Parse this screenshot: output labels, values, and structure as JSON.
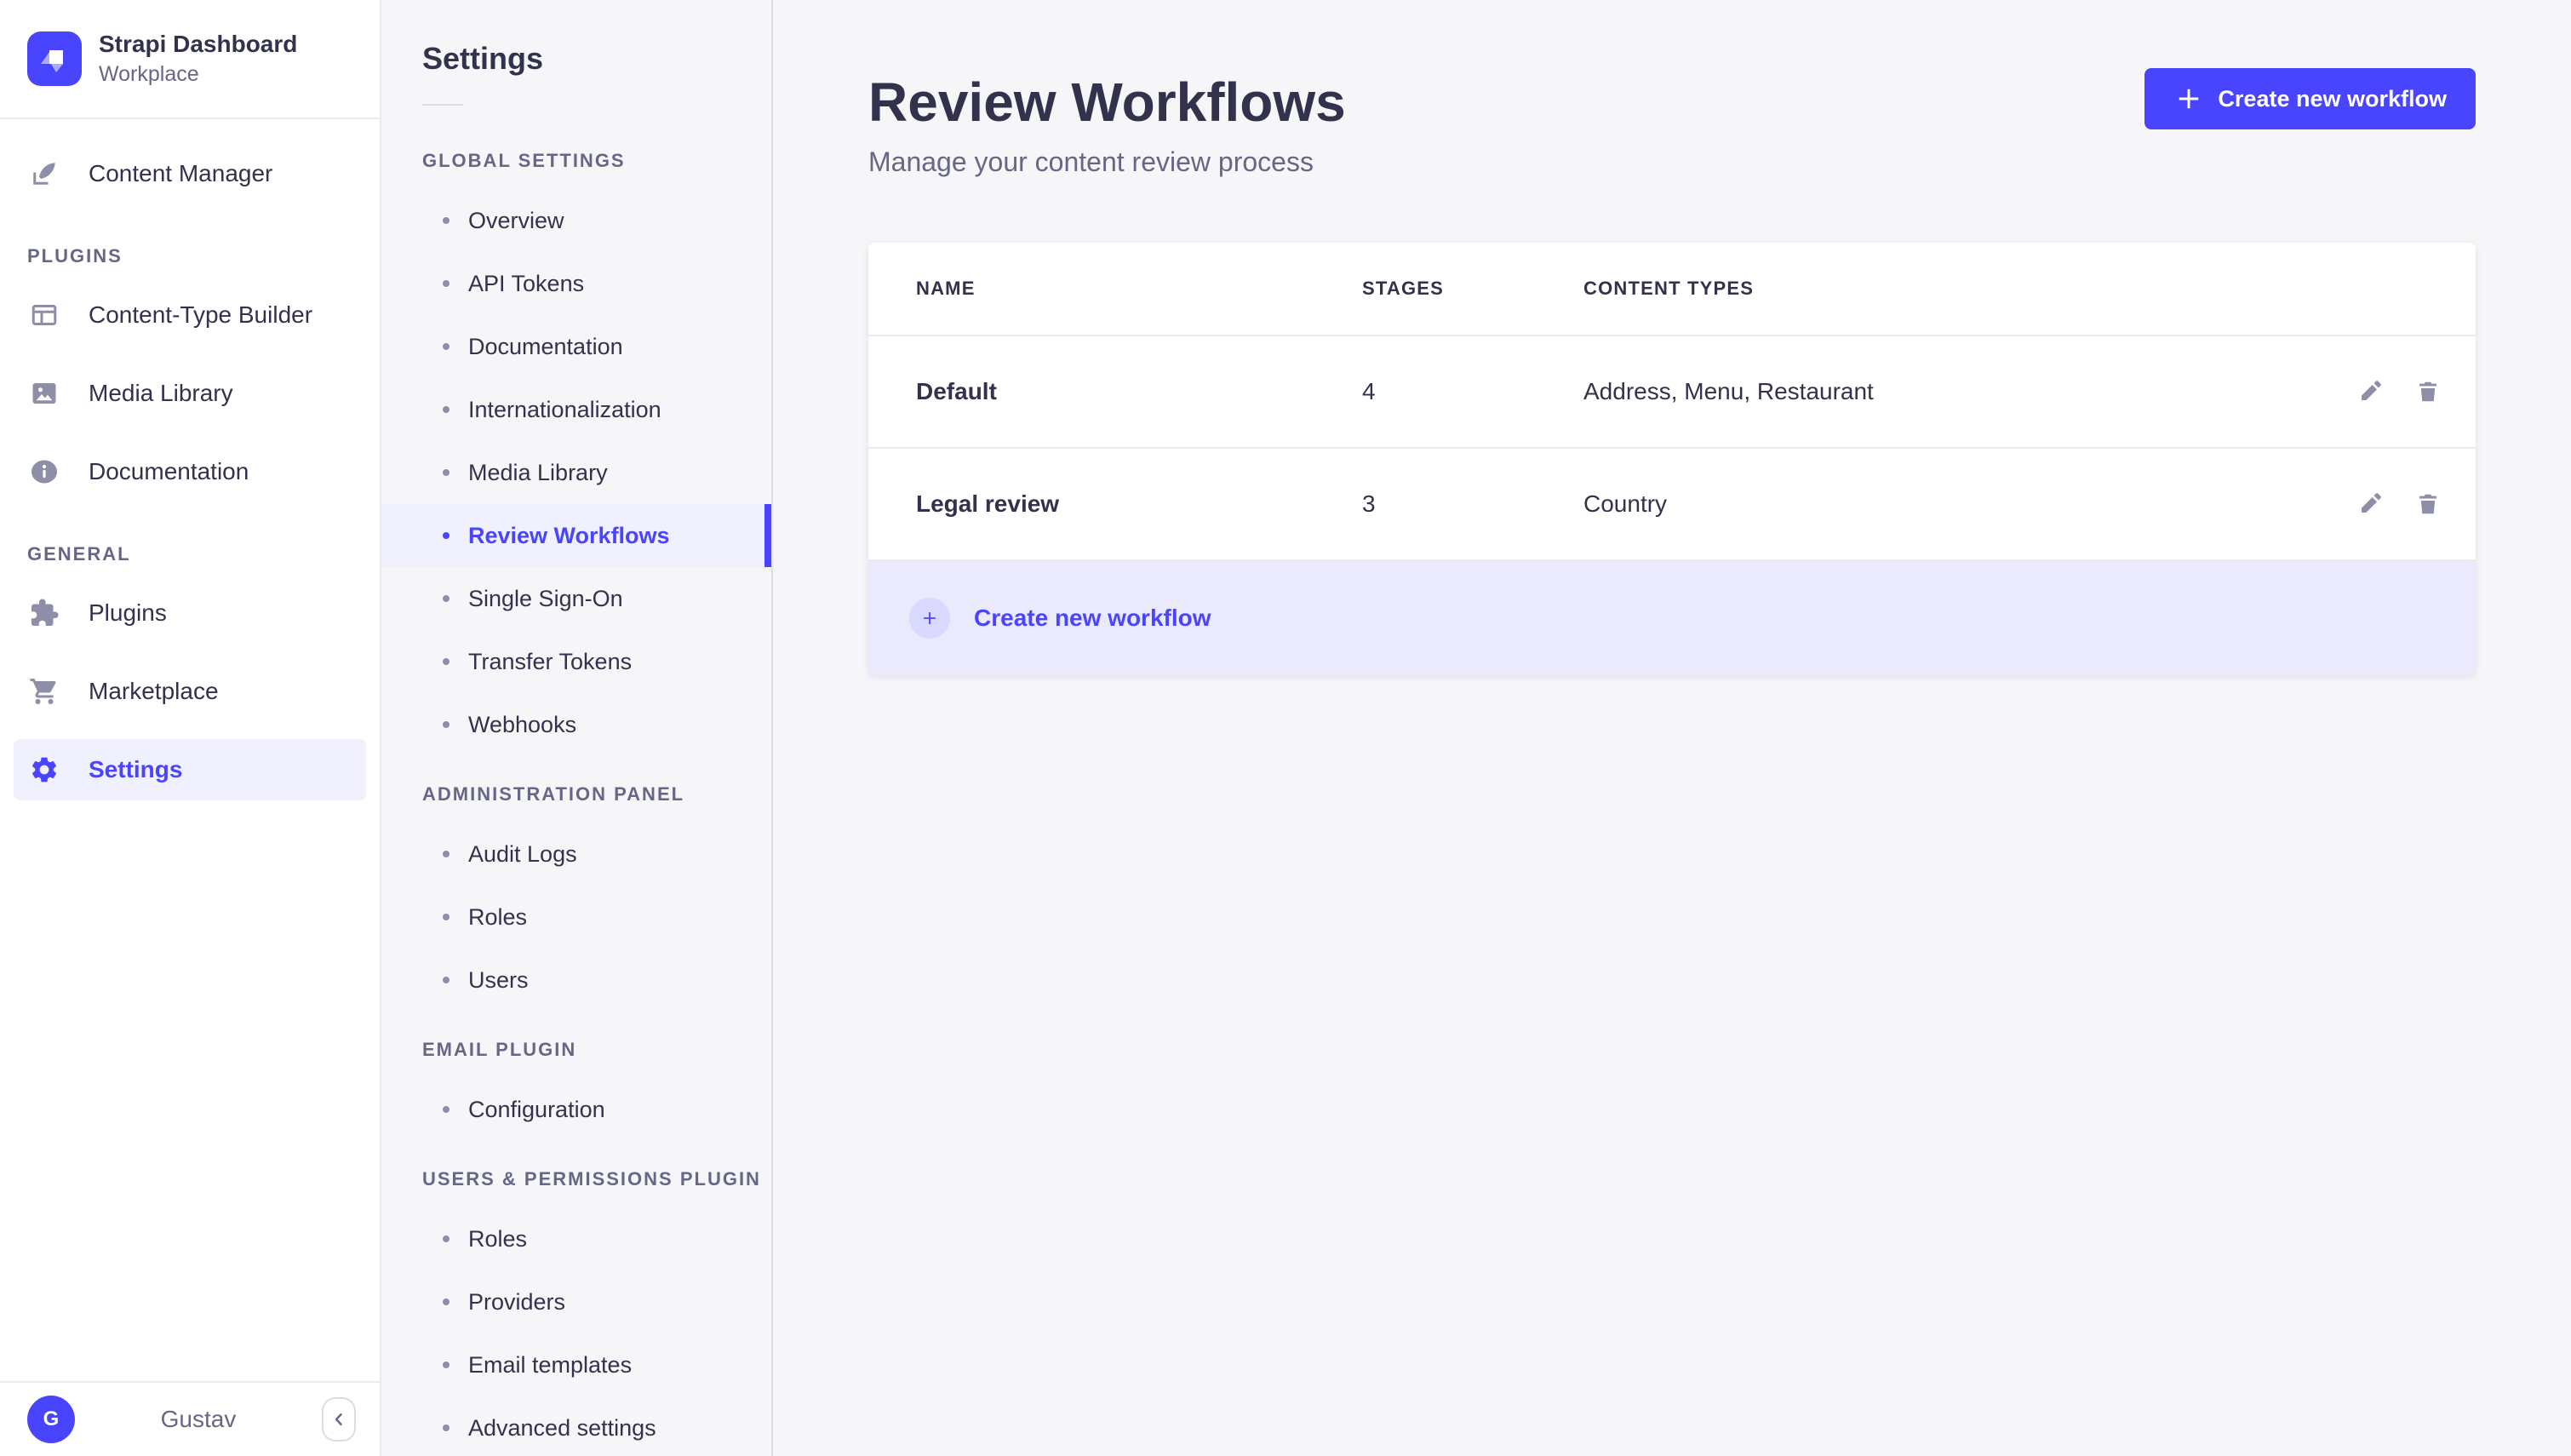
{
  "brand": {
    "name": "Strapi Dashboard",
    "workspace": "Workplace"
  },
  "main_nav": {
    "top_items": [
      {
        "label": "Content Manager",
        "icon": "content-manager-icon"
      }
    ],
    "sections": [
      {
        "label": "PLUGINS",
        "items": [
          {
            "label": "Content-Type Builder",
            "icon": "content-type-builder-icon"
          },
          {
            "label": "Media Library",
            "icon": "media-library-icon"
          },
          {
            "label": "Documentation",
            "icon": "documentation-icon"
          }
        ]
      },
      {
        "label": "GENERAL",
        "items": [
          {
            "label": "Plugins",
            "icon": "plugins-icon"
          },
          {
            "label": "Marketplace",
            "icon": "marketplace-icon"
          },
          {
            "label": "Settings",
            "icon": "settings-icon",
            "active": true
          }
        ]
      }
    ],
    "user": {
      "initial": "G",
      "name": "Gustav"
    }
  },
  "subnav": {
    "title": "Settings",
    "sections": [
      {
        "label": "GLOBAL SETTINGS",
        "items": [
          "Overview",
          "API Tokens",
          "Documentation",
          "Internationalization",
          "Media Library",
          "Review Workflows",
          "Single Sign-On",
          "Transfer Tokens",
          "Webhooks"
        ],
        "active_item": "Review Workflows"
      },
      {
        "label": "ADMINISTRATION PANEL",
        "items": [
          "Audit Logs",
          "Roles",
          "Users"
        ]
      },
      {
        "label": "EMAIL PLUGIN",
        "items": [
          "Configuration"
        ]
      },
      {
        "label": "USERS & PERMISSIONS PLUGIN",
        "items": [
          "Roles",
          "Providers",
          "Email templates",
          "Advanced settings"
        ]
      }
    ]
  },
  "page": {
    "title": "Review Workflows",
    "subtitle": "Manage your content review process",
    "create_button_label": "Create new workflow",
    "table": {
      "headers": [
        "NAME",
        "STAGES",
        "CONTENT TYPES"
      ],
      "rows": [
        {
          "name": "Default",
          "stages": "4",
          "content_types": "Address, Menu, Restaurant"
        },
        {
          "name": "Legal review",
          "stages": "3",
          "content_types": "Country"
        }
      ],
      "footer_action_label": "Create new workflow",
      "row_actions": [
        "edit-icon",
        "delete-icon"
      ]
    }
  },
  "colors": {
    "primary": "#4945ff",
    "primary_light_bg": "#f0f0ff",
    "footer_row_bg": "#eaeafc",
    "text_primary": "#32324d",
    "text_secondary": "#666687",
    "icon_gray": "#8e8ea9",
    "border": "#eaeaef",
    "page_bg": "#f6f6f9"
  }
}
